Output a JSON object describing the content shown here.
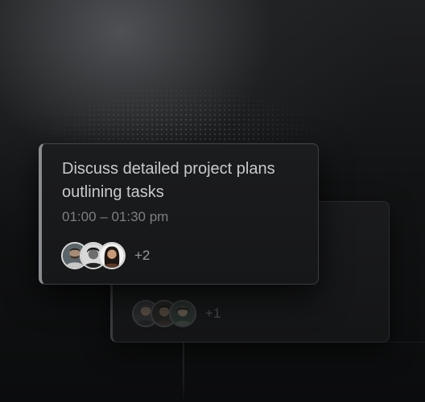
{
  "events": [
    {
      "title": "Discuss detailed project plans outlining tasks",
      "time": "01:00 – 01:30 pm",
      "avatars": [
        "avatar-man-beard",
        "avatar-man-dark-hair",
        "avatar-woman-long-hair"
      ],
      "extra_attendees": "+2"
    },
    {
      "avatars": [
        "avatar-man",
        "avatar-man-curly-hair",
        "avatar-woman"
      ],
      "extra_attendees": "+1"
    }
  ],
  "colors": {
    "background": "#0b0c0d",
    "card": "#1b1c1e",
    "title_text": "#c9cacc",
    "time_text": "#7d7f83",
    "front_accent": "#8a8c90"
  }
}
